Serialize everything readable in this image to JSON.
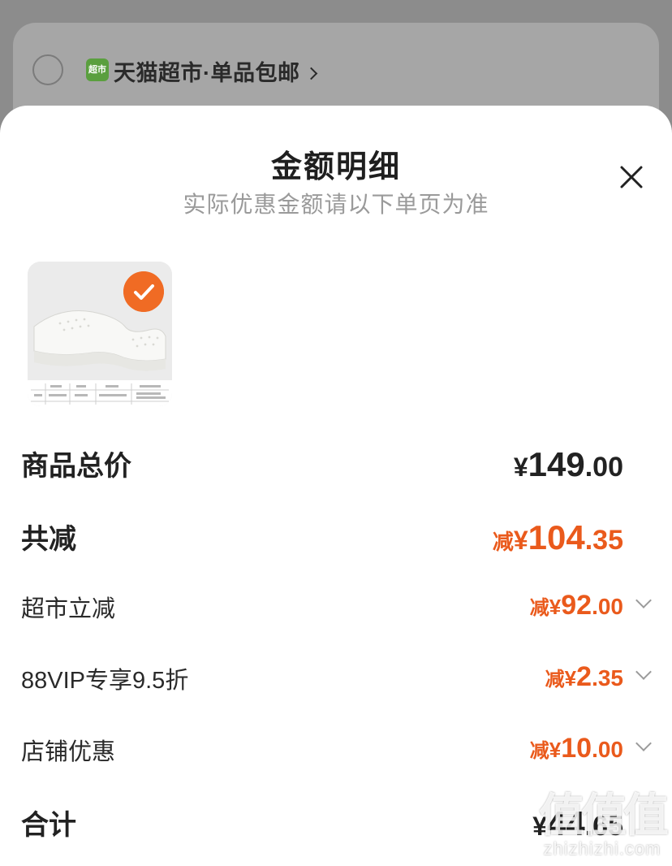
{
  "background": {
    "logo_text": "超市",
    "store_name": "天猫超市·单品包邮"
  },
  "sheet": {
    "title": "金额明细",
    "subtitle": "实际优惠金额请以下单页为准"
  },
  "rows": {
    "total_price": {
      "label": "商品总价",
      "yen": "¥",
      "int": "149",
      "dec": ".00"
    },
    "total_discount": {
      "label": "共减",
      "minus": "减",
      "yen": "¥",
      "int": "104",
      "dec": ".35"
    },
    "supermarket": {
      "label": "超市立减",
      "minus": "减",
      "yen": "¥",
      "int": "92",
      "dec": ".00"
    },
    "vip": {
      "label": "88VIP专享9.5折",
      "minus": "减",
      "yen": "¥",
      "int": "2",
      "dec": ".35"
    },
    "store": {
      "label": "店铺优惠",
      "minus": "减",
      "yen": "¥",
      "int": "10",
      "dec": ".00"
    },
    "sum": {
      "label": "合计",
      "yen": "¥",
      "int": "44",
      "dec": ".65"
    }
  },
  "watermark": {
    "main": "值值值",
    "sub": "zhizhizhi.com"
  },
  "colors": {
    "accent": "#ea5a1c",
    "check_badge": "#f06b24",
    "dim_overlay": "#8c8c8c"
  }
}
